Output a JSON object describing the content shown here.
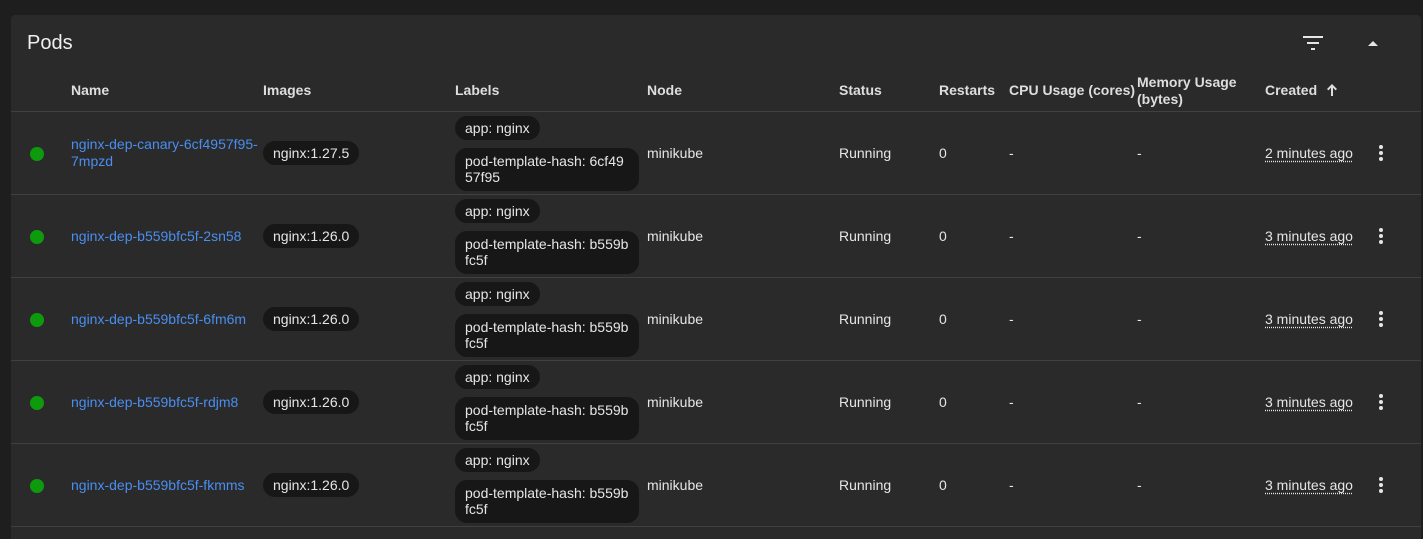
{
  "panel": {
    "title": "Pods",
    "filter_icon": "filter-icon",
    "collapse_icon": "collapse-up-icon"
  },
  "columns": {
    "name": "Name",
    "images": "Images",
    "labels": "Labels",
    "node": "Node",
    "status": "Status",
    "restarts": "Restarts",
    "cpu": "CPU Usage (cores)",
    "memory": "Memory Usage (bytes)",
    "created": "Created",
    "created_sort": "ascending"
  },
  "rows": [
    {
      "status_color": "#0d9b0d",
      "name": "nginx-dep-canary-6cf4957f95-7mpzd",
      "image": "nginx:1.27.5",
      "label_app": "app: nginx",
      "label_hash": "pod-template-hash: 6cf4957f95",
      "node": "minikube",
      "status": "Running",
      "restarts": "0",
      "cpu": "-",
      "memory": "-",
      "created": "2 minutes ago"
    },
    {
      "status_color": "#0d9b0d",
      "name": "nginx-dep-b559bfc5f-2sn58",
      "image": "nginx:1.26.0",
      "label_app": "app: nginx",
      "label_hash": "pod-template-hash: b559bfc5f",
      "node": "minikube",
      "status": "Running",
      "restarts": "0",
      "cpu": "-",
      "memory": "-",
      "created": "3 minutes ago"
    },
    {
      "status_color": "#0d9b0d",
      "name": "nginx-dep-b559bfc5f-6fm6m",
      "image": "nginx:1.26.0",
      "label_app": "app: nginx",
      "label_hash": "pod-template-hash: b559bfc5f",
      "node": "minikube",
      "status": "Running",
      "restarts": "0",
      "cpu": "-",
      "memory": "-",
      "created": "3 minutes ago"
    },
    {
      "status_color": "#0d9b0d",
      "name": "nginx-dep-b559bfc5f-rdjm8",
      "image": "nginx:1.26.0",
      "label_app": "app: nginx",
      "label_hash": "pod-template-hash: b559bfc5f",
      "node": "minikube",
      "status": "Running",
      "restarts": "0",
      "cpu": "-",
      "memory": "-",
      "created": "3 minutes ago"
    },
    {
      "status_color": "#0d9b0d",
      "name": "nginx-dep-b559bfc5f-fkmms",
      "image": "nginx:1.26.0",
      "label_app": "app: nginx",
      "label_hash": "pod-template-hash: b559bfc5f",
      "node": "minikube",
      "status": "Running",
      "restarts": "0",
      "cpu": "-",
      "memory": "-",
      "created": "3 minutes ago"
    }
  ]
}
